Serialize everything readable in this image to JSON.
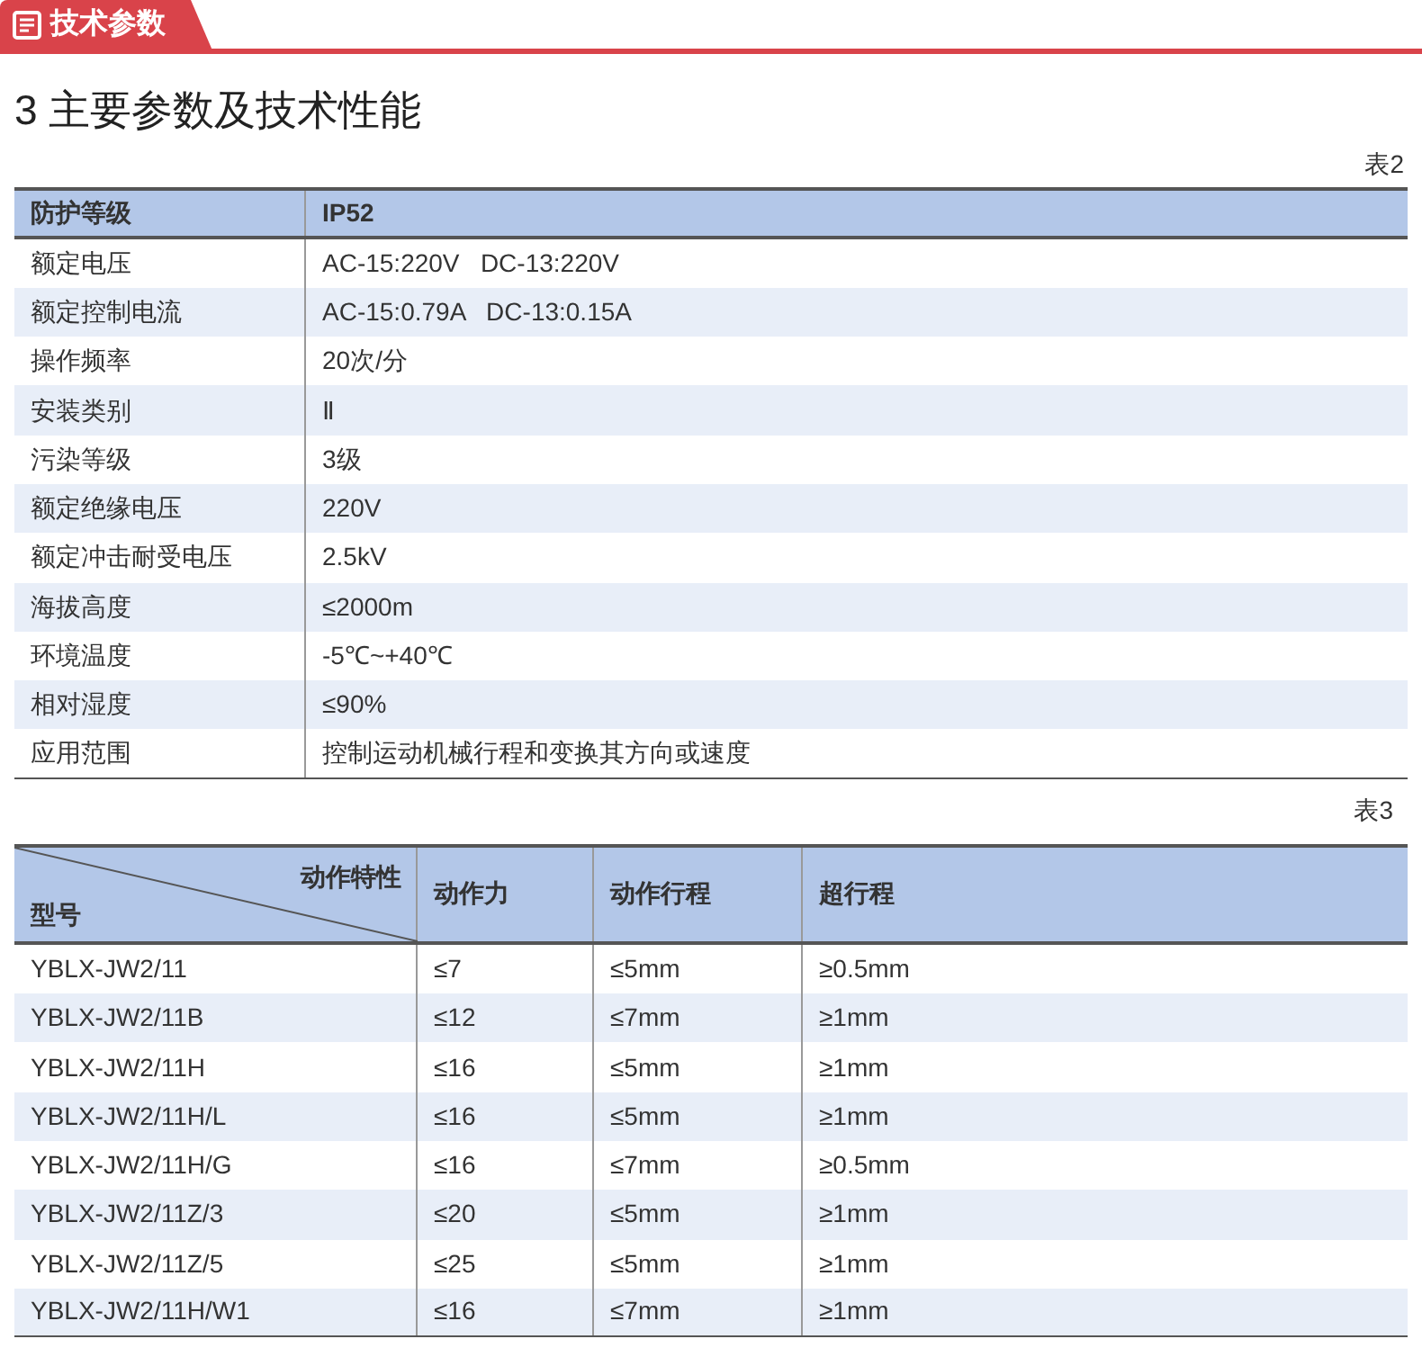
{
  "tab": {
    "label": "技术参数"
  },
  "title": "3 主要参数及技术性能",
  "table1": {
    "caption": "表2",
    "header": [
      "防护等级",
      "IP52"
    ],
    "rows": [
      [
        "额定电压",
        "AC-15:220V   DC-13:220V"
      ],
      [
        "额定控制电流",
        "AC-15:0.79A   DC-13:0.15A"
      ],
      [
        "操作频率",
        "20次/分"
      ],
      [
        "安装类别",
        "Ⅱ"
      ],
      [
        "污染等级",
        "3级"
      ],
      [
        "额定绝缘电压",
        "220V"
      ],
      [
        "额定冲击耐受电压",
        "2.5kV"
      ],
      [
        "海拔高度",
        "≤2000m"
      ],
      [
        "环境温度",
        "-5℃~+40℃"
      ],
      [
        "相对湿度",
        "≤90%"
      ],
      [
        "应用范围",
        "控制运动机械行程和变换其方向或速度"
      ]
    ]
  },
  "table2": {
    "caption": "表3",
    "columns": [
      {
        "kind": "diagonal",
        "top": "动作特性",
        "bottom": "型号"
      },
      {
        "kind": "plain",
        "label": "动作力"
      },
      {
        "kind": "plain",
        "label": "动作行程"
      },
      {
        "kind": "plain",
        "label": "超行程"
      }
    ],
    "rows": [
      [
        "YBLX-JW2/11",
        "≤7",
        "≤5mm",
        "≥0.5mm"
      ],
      [
        "YBLX-JW2/11B",
        "≤12",
        "≤7mm",
        "≥1mm"
      ],
      [
        "YBLX-JW2/11H",
        "≤16",
        "≤5mm",
        "≥1mm"
      ],
      [
        "YBLX-JW2/11H/L",
        "≤16",
        "≤5mm",
        "≥1mm"
      ],
      [
        "YBLX-JW2/11H/G",
        "≤16",
        "≤7mm",
        "≥0.5mm"
      ],
      [
        "YBLX-JW2/11Z/3",
        "≤20",
        "≤5mm",
        "≥1mm"
      ],
      [
        "YBLX-JW2/11Z/5",
        "≤25",
        "≤5mm",
        "≥1mm"
      ],
      [
        "YBLX-JW2/11H/W1",
        "≤16",
        "≤7mm",
        "≥1mm"
      ]
    ]
  }
}
